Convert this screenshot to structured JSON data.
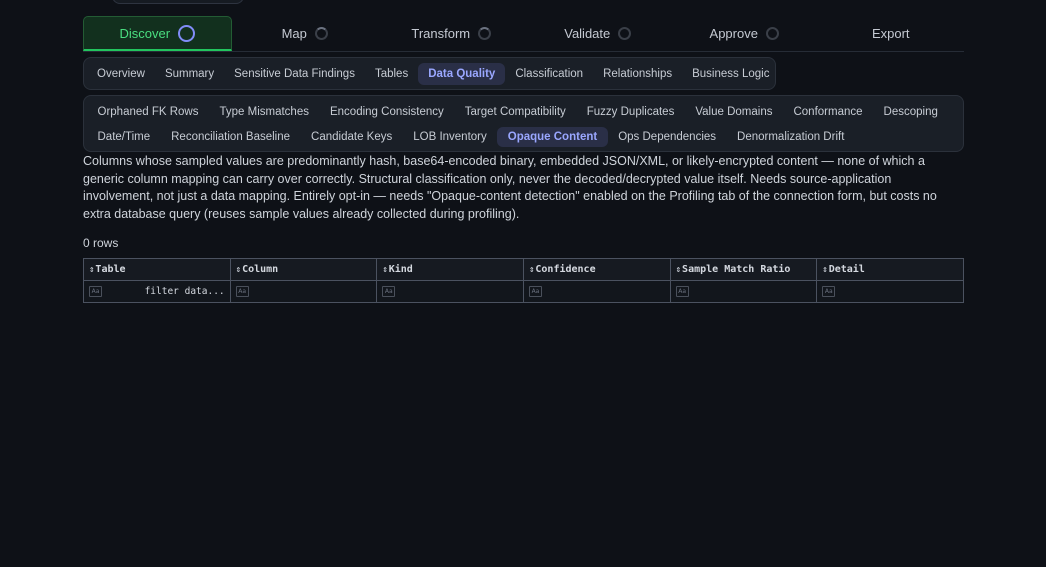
{
  "stepper": [
    {
      "label": "Discover",
      "state": "active"
    },
    {
      "label": "Map",
      "state": "partial"
    },
    {
      "label": "Transform",
      "state": "partial"
    },
    {
      "label": "Validate",
      "state": "empty"
    },
    {
      "label": "Approve",
      "state": "empty"
    },
    {
      "label": "Export",
      "state": "none"
    }
  ],
  "primary_tabs": [
    "Overview",
    "Summary",
    "Sensitive Data Findings",
    "Tables",
    "Data Quality",
    "Classification",
    "Relationships",
    "Business Logic"
  ],
  "primary_active": "Data Quality",
  "secondary_tabs_row1": [
    "Orphaned FK Rows",
    "Type Mismatches",
    "Encoding Consistency",
    "Target Compatibility",
    "Fuzzy Duplicates",
    "Value Domains",
    "Conformance",
    "Descoping"
  ],
  "secondary_tabs_row2": [
    "Date/Time",
    "Reconciliation Baseline",
    "Candidate Keys",
    "LOB Inventory",
    "Opaque Content",
    "Ops Dependencies",
    "Denormalization Drift"
  ],
  "secondary_active": "Opaque Content",
  "description": "Columns whose sampled values are predominantly hash, base64-encoded binary, embedded JSON/XML, or likely-encrypted content — none of which a generic column mapping can carry over correctly. Structural classification only, never the decoded/decrypted value itself. Needs source-application involvement, not just a data mapping. Entirely opt-in — needs \"Opaque-content detection\" enabled on the Profiling tab of the connection form, but costs no extra database query (reuses sample values already collected during profiling).",
  "row_count": "0 rows",
  "grid": {
    "columns": [
      "Table",
      "Column",
      "Kind",
      "Confidence",
      "Sample Match Ratio",
      "Detail"
    ],
    "sort_glyph": "⇕",
    "filter_placeholder": "filter data...",
    "filter_icon_glyph": "Aa"
  }
}
